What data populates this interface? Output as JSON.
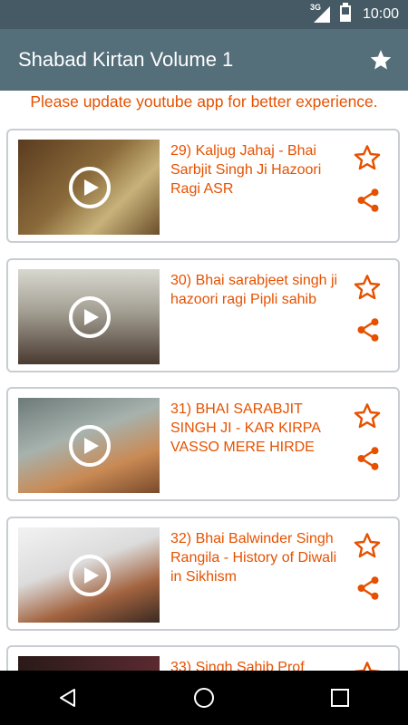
{
  "status_bar": {
    "network": "3G",
    "time": "10:00"
  },
  "app_bar": {
    "title": "Shabad Kirtan Volume 1",
    "favorites_icon": "star-icon"
  },
  "notice": "Please update youtube app for better experience.",
  "videos": [
    {
      "title": "29) Kaljug Jahaj - Bhai Sarbjit Singh Ji Hazoori Ragi ASR"
    },
    {
      "title": "30) Bhai sarabjeet singh ji hazoori ragi Pipli sahib"
    },
    {
      "title": "31) BHAI SARABJIT SINGH JI - KAR KIRPA VASSO MERE HIRDE"
    },
    {
      "title": "32) Bhai Balwinder Singh Rangila - History of Diwali in Sikhism"
    },
    {
      "title": "33) Singh Sahib Prof"
    }
  ],
  "colors": {
    "accent": "#E65100",
    "app_bar": "#546E7A",
    "status_bar": "#455A64",
    "card_border": "#C9CDD2"
  },
  "icons": {
    "card_fav": "star-outline-icon",
    "card_share": "share-icon",
    "play": "play-icon"
  }
}
